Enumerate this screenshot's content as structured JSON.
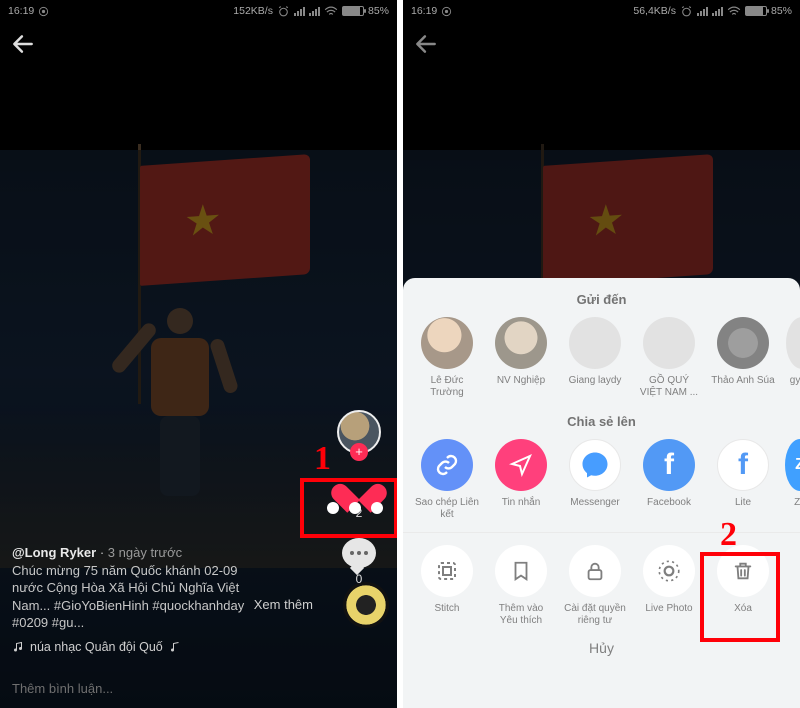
{
  "left": {
    "status": {
      "time": "16:19",
      "speed": "152KB/s",
      "battery": "85%"
    },
    "profile": {
      "username": "@Long Ryker",
      "date": "3 ngày trước"
    },
    "caption": {
      "l1": "Chúc mừng 75 năm Quốc khánh 02-09",
      "l2": "nước Cộng Hòa Xã Hội Chủ Nghĩa Việt",
      "l3": "Nam... #GioYoBienHinh #quockhanhday",
      "l4": "#0209 #gu..."
    },
    "seemore": "Xem thêm",
    "music": "núa nhạc Quân đội   Quố",
    "likeCount": "2",
    "commentCount": "0",
    "addComment": "Thêm bình luận...",
    "marker": "1"
  },
  "right": {
    "status": {
      "time": "16:19",
      "speed": "56,4KB/s",
      "battery": "85%"
    },
    "marker": "2",
    "sheet": {
      "sendTo": "Gửi đến",
      "contacts": [
        {
          "name": "Lê Đức Trường"
        },
        {
          "name": "NV Nghiệp"
        },
        {
          "name": "Giang laydy"
        },
        {
          "name": "GỒ QUÝ VIỆT NAM ..."
        },
        {
          "name": "Thảo Anh Súa"
        },
        {
          "name": "gymp"
        }
      ],
      "shareTo": "Chia sẻ lên",
      "share": [
        {
          "name": "Sao chép Liên kết"
        },
        {
          "name": "Tin nhắn"
        },
        {
          "name": "Messenger"
        },
        {
          "name": "Facebook"
        },
        {
          "name": "Lite"
        },
        {
          "name": "Za"
        }
      ],
      "actions": [
        {
          "name": "Stitch"
        },
        {
          "name": "Thêm vào Yêu thích"
        },
        {
          "name": "Cài đặt quyền riêng tư"
        },
        {
          "name": "Live Photo"
        },
        {
          "name": "Xóa"
        }
      ],
      "cancel": "Hủy"
    }
  }
}
